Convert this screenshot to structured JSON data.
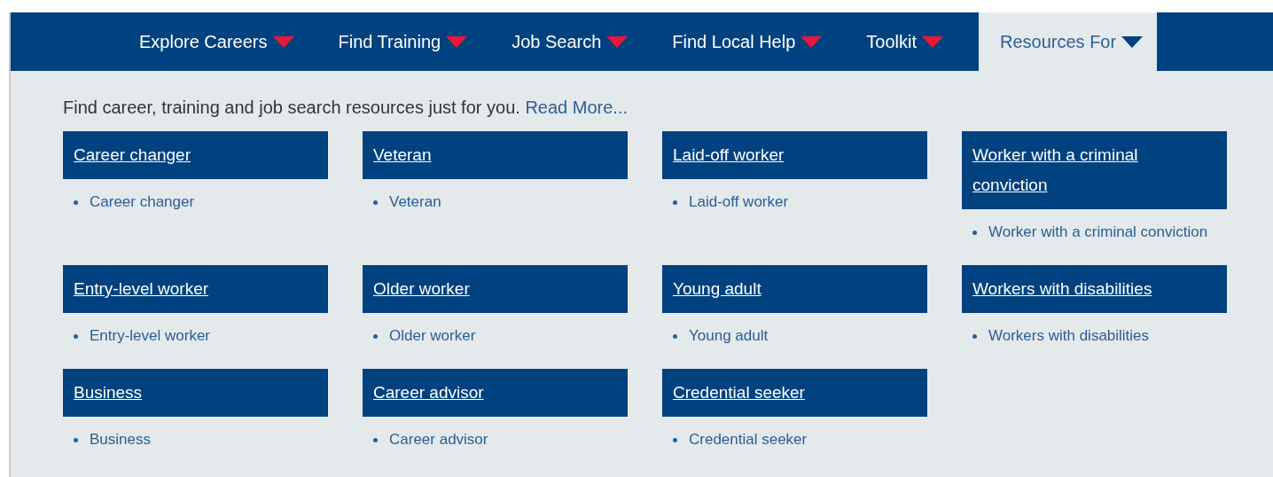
{
  "nav": {
    "items": [
      {
        "label": "Explore Careers",
        "selected": false
      },
      {
        "label": "Find Training",
        "selected": false
      },
      {
        "label": "Job Search",
        "selected": false
      },
      {
        "label": "Find Local Help",
        "selected": false
      },
      {
        "label": "Toolkit",
        "selected": false
      },
      {
        "label": "Resources For",
        "selected": true
      }
    ]
  },
  "intro": {
    "text": "Find career, training and job search resources just for you.",
    "link": "Read More..."
  },
  "groups": [
    {
      "title": "Career changer",
      "links": [
        "Career changer"
      ]
    },
    {
      "title": "Veteran",
      "links": [
        "Veteran"
      ]
    },
    {
      "title": "Laid-off worker",
      "links": [
        "Laid-off worker"
      ]
    },
    {
      "title": "Worker with a criminal conviction",
      "links": [
        "Worker with a criminal conviction"
      ]
    },
    {
      "title": "Entry-level worker",
      "links": [
        "Entry-level worker"
      ]
    },
    {
      "title": "Older worker",
      "links": [
        "Older worker"
      ]
    },
    {
      "title": "Young adult",
      "links": [
        "Young adult"
      ]
    },
    {
      "title": "Workers with disabilities",
      "links": [
        "Workers with disabilities"
      ]
    },
    {
      "title": "Business",
      "links": [
        "Business"
      ]
    },
    {
      "title": "Career advisor",
      "links": [
        "Career advisor"
      ]
    },
    {
      "title": "Credential seeker",
      "links": [
        "Credential seeker"
      ]
    }
  ]
}
